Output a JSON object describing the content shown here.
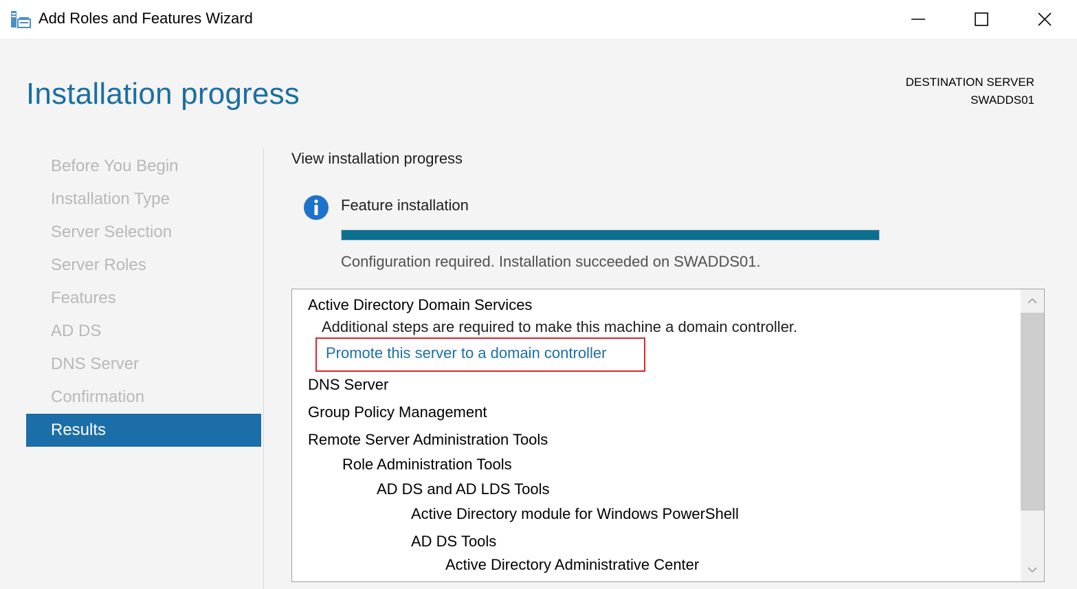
{
  "window": {
    "title": "Add Roles and Features Wizard",
    "icon": "server-manager-icon",
    "controls": [
      "minimize-icon",
      "maximize-icon",
      "close-icon"
    ]
  },
  "header": {
    "page_title": "Installation progress",
    "destination_label": "DESTINATION SERVER",
    "destination_server": "SWADDS01"
  },
  "nav": {
    "items": [
      {
        "label": "Before You Begin",
        "active": false
      },
      {
        "label": "Installation Type",
        "active": false
      },
      {
        "label": "Server Selection",
        "active": false
      },
      {
        "label": "Server Roles",
        "active": false
      },
      {
        "label": "Features",
        "active": false
      },
      {
        "label": "AD DS",
        "active": false
      },
      {
        "label": "DNS Server",
        "active": false
      },
      {
        "label": "Confirmation",
        "active": false
      },
      {
        "label": "Results",
        "active": true
      }
    ]
  },
  "main": {
    "heading": "View installation progress",
    "feature_label": "Feature installation",
    "progress_percent": 100,
    "status": "Configuration required. Installation succeeded on SWADDS01.",
    "results": {
      "ad_ds": "Active Directory Domain Services",
      "ad_ds_note": "Additional steps are required to make this machine a domain controller.",
      "promote_link": "Promote this server to a domain controller",
      "dns": "DNS Server",
      "gpm": "Group Policy Management",
      "rsat": "Remote Server Administration Tools",
      "role_admin": "Role Administration Tools",
      "adds_lds": "AD DS and AD LDS Tools",
      "ad_module": "Active Directory module for Windows PowerShell",
      "adds_tools": "AD DS Tools",
      "adac": "Active Directory Administrative Center"
    }
  },
  "colors": {
    "accent": "#1b6ea8",
    "title": "#1a6fa2",
    "progress": "#0b6f90",
    "highlight": "#d9262d"
  }
}
